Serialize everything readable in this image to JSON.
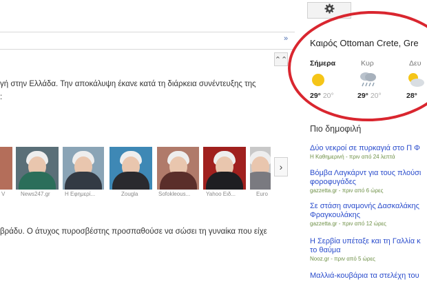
{
  "results": {
    "expand_label": "»",
    "collapse_label": "⌃⌃",
    "snippet_1": "γή στην Ελλάδα. Την αποκάλυψη έκανε κατά τη διάρκεια συνέντευξης της",
    "snippet_2": "βράδυ. Ο άτυχος πυροσβέστης προσπαθούσε να σώσει τη γυναίκα που είχε",
    "images": [
      {
        "label": "V"
      },
      {
        "label": "News247.gr"
      },
      {
        "label": "Η Εφημερί..."
      },
      {
        "label": "Zougla"
      },
      {
        "label": "Sofokleous..."
      },
      {
        "label": "Yahoo Ειδ..."
      },
      {
        "label": "Euro"
      }
    ],
    "next_label": "›"
  },
  "settings": {
    "icon": "gear-icon"
  },
  "weather": {
    "title": "Καιρός Ottoman Crete, Gre",
    "days": [
      {
        "name": "Σήμερα",
        "icon": "sun-icon",
        "high": "29°",
        "low": "20°"
      },
      {
        "name": "Κυρ",
        "icon": "rain-cloud-icon",
        "high": "29°",
        "low": "20°"
      },
      {
        "name": "Δευ",
        "icon": "partly-cloudy-icon",
        "high": "28°",
        "low": ""
      }
    ]
  },
  "popular": {
    "title": "Πιο δημοφιλή",
    "items": [
      {
        "headline": "Δύο νεκροί σε πυρκαγιά στο Π Φ",
        "meta": "Η Καθημερινή - πριν από 24 λεπτά"
      },
      {
        "headline": "Βόμβα Λαγκάρντ για τους πλούσι",
        "headline2": "φοροφυγάδες",
        "meta": "gazzetta.gr - πριν από 6 ώρες"
      },
      {
        "headline": "Σε στάση αναμονής Δασκαλάκης",
        "headline2": "Φραγκουλάκης",
        "meta": "gazzetta.gr - πριν από 12 ώρες"
      },
      {
        "headline": "Η Σερβία υπέταξε και τη Γαλλία κ",
        "headline2": "το θαύμα",
        "meta": "Nooz.gr - πριν από 5 ώρες"
      },
      {
        "headline": "Μαλλιά-κουβάρια τα στελέχη του",
        "meta": ""
      }
    ]
  }
}
